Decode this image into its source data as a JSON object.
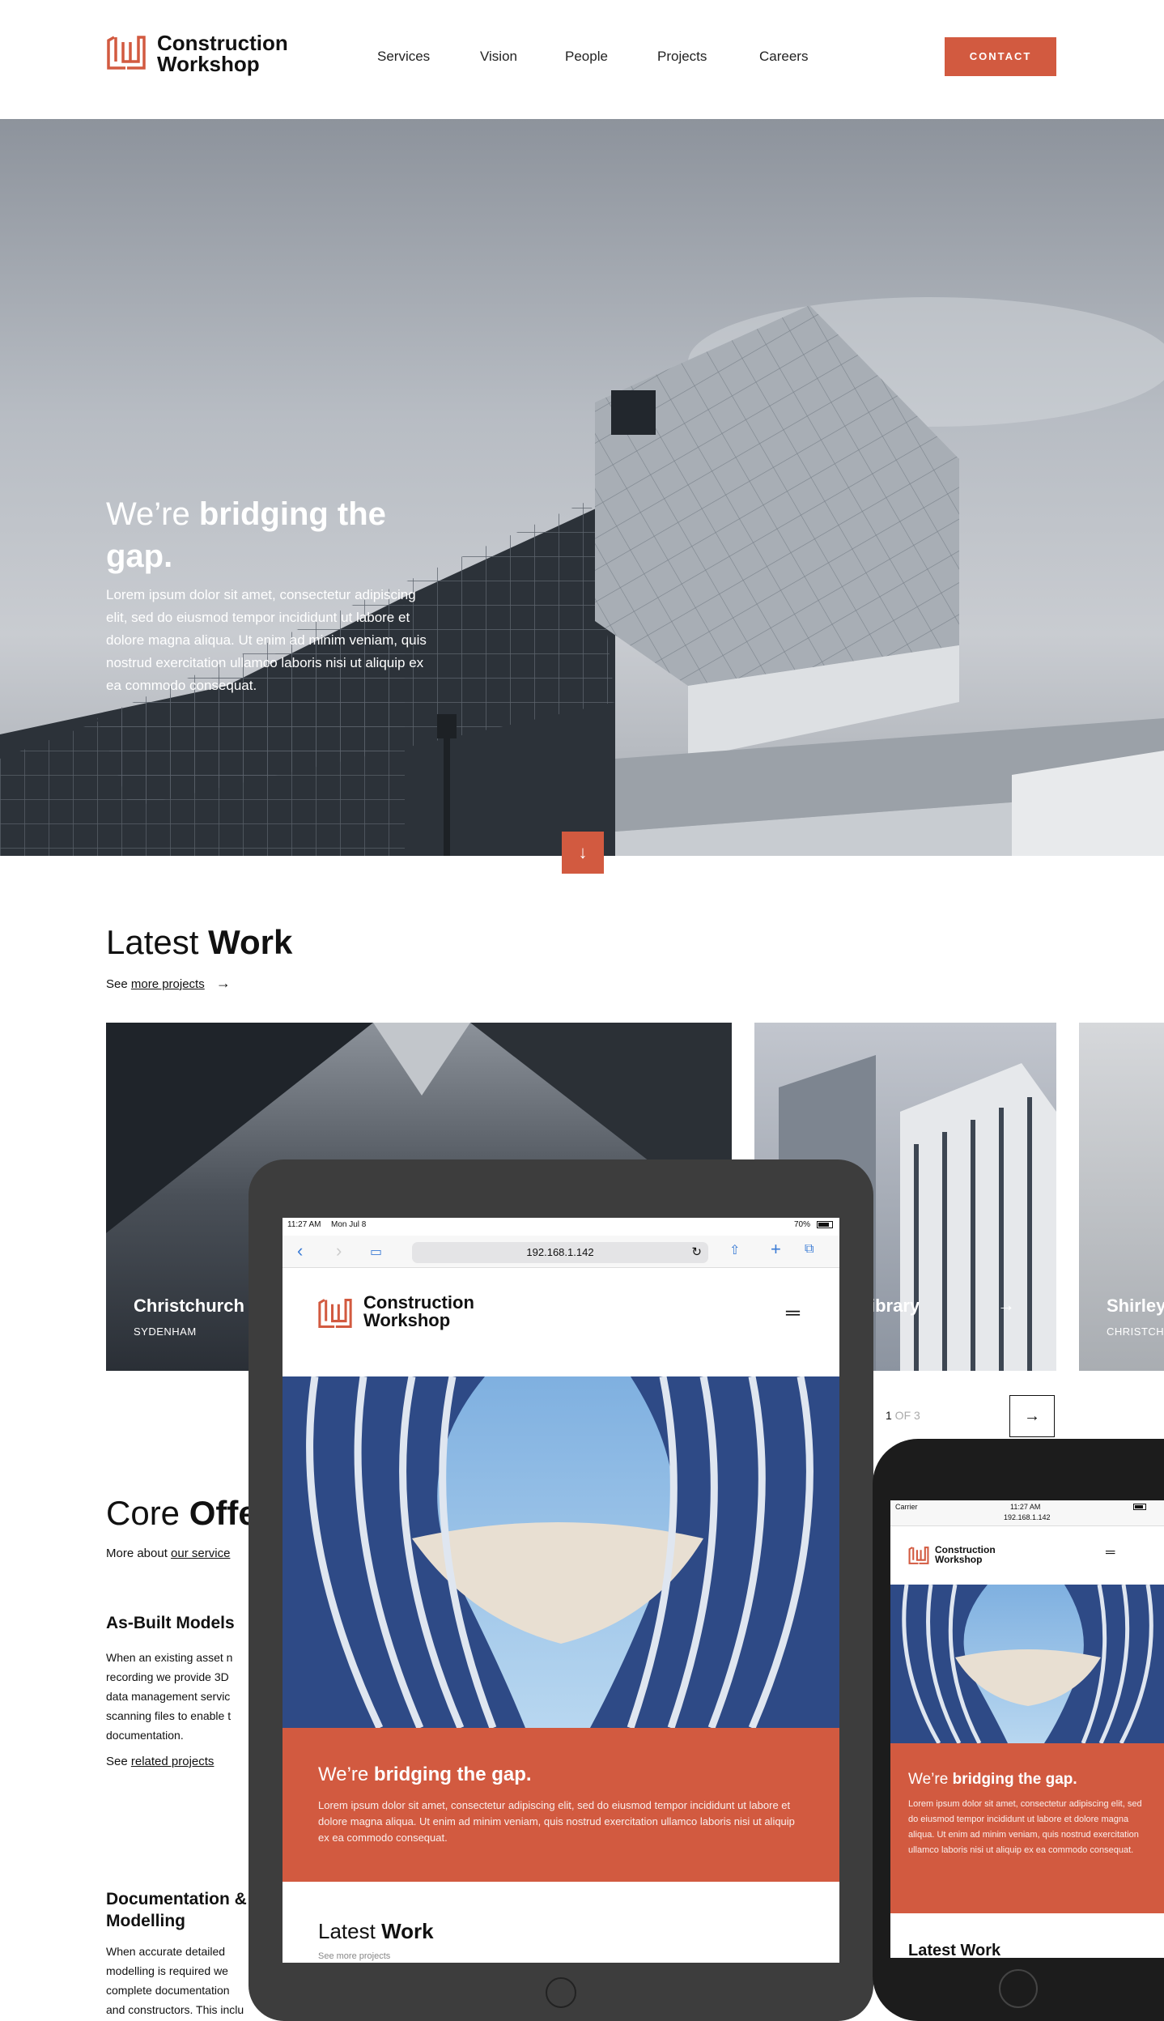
{
  "brand": {
    "line1": "Construction",
    "line2": "Workshop",
    "accent": "#d25a40"
  },
  "nav": {
    "items": [
      "Services",
      "Vision",
      "People",
      "Projects",
      "Careers"
    ],
    "contact": "CONTACT"
  },
  "hero": {
    "title_plain": "We’re ",
    "title_bold": "bridging the gap.",
    "body": "Lorem ipsum dolor sit amet, consectetur adipiscing elit, sed do eiusmod tempor incididunt ut labore et dolore magna aliqua. Ut enim ad minim veniam, quis nostrud exercitation ullamco laboris nisi ut aliquip ex ea commodo consequat.",
    "scroll_icon": "arrow-down-icon"
  },
  "latest": {
    "title_plain": "Latest ",
    "title_bold": "Work",
    "see": "See ",
    "link": "more projects",
    "cards": [
      {
        "title": "Christchurch",
        "sub": "SYDENHAM"
      },
      {
        "title": "n Library",
        "sub": ""
      },
      {
        "title": "Shirley",
        "sub": "CHRISTCH"
      }
    ],
    "pager": {
      "current": "1",
      "rest": " OF 3"
    }
  },
  "core": {
    "title_plain": "Core ",
    "title_bold": "Offe",
    "more": "More about ",
    "link": "our service",
    "items": [
      {
        "title": "As-Built Models",
        "lines": [
          "When an existing asset n",
          "recording we provide 3D",
          "data management servic",
          "scanning files to enable t",
          "documentation."
        ],
        "see": "See ",
        "link": "related projects"
      },
      {
        "title": "Documentation &",
        "title2": "Modelling",
        "lines": [
          "When accurate detailed",
          "modelling is required we",
          "complete documentation",
          "and constructors. This inclu"
        ]
      }
    ]
  },
  "tablet": {
    "time": "11:27 AM",
    "date": "Mon Jul 8",
    "battery": "70%",
    "url": "192.168.1.142",
    "hero_plain": "We’re ",
    "hero_bold": "bridging the gap.",
    "hero_body": "Lorem ipsum dolor sit amet, consectetur adipiscing elit, sed do eiusmod tempor incididunt ut labore et dolore magna aliqua. Ut enim ad minim veniam, quis nostrud exercitation ullamco laboris nisi ut aliquip ex ea commodo consequat.",
    "latest_plain": "Latest ",
    "latest_bold": "Work",
    "see_more": "See more projects"
  },
  "phone": {
    "carrier": "Carrier",
    "time": "11:27 AM",
    "url": "192.168.1.142",
    "hero_plain": "We’re ",
    "hero_bold": "bridging the gap.",
    "hero_body": "Lorem ipsum dolor sit amet, consectetur adipiscing elit, sed do eiusmod tempor incididunt ut labore et dolore magna aliqua. Ut enim ad minim veniam, quis nostrud exercitation ullamco laboris nisi ut aliquip ex ea commodo consequat.",
    "latest": "Latest Work"
  }
}
